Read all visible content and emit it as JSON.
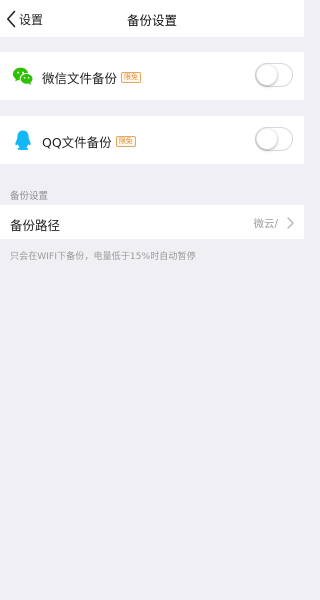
{
  "navbar": {
    "back_label": "设置",
    "title": "备份设置"
  },
  "wechat_backup": {
    "icon": "wechat-icon",
    "label": "微信文件备份",
    "badge": "限免",
    "enabled": false
  },
  "qq_backup": {
    "icon": "qq-penguin-icon",
    "label": "QQ文件备份",
    "badge": "限免",
    "enabled": false
  },
  "backup_settings": {
    "section_title": "备份设置",
    "path_label": "备份路径",
    "path_value": "微云/",
    "footnote": "只会在WIFI下备份，电量低于15%时自动暂停"
  },
  "colors": {
    "background": "#efeff4",
    "wechat_green": "#2dc100",
    "qq_blue": "#12b7f5",
    "badge_orange": "#d9913e"
  }
}
